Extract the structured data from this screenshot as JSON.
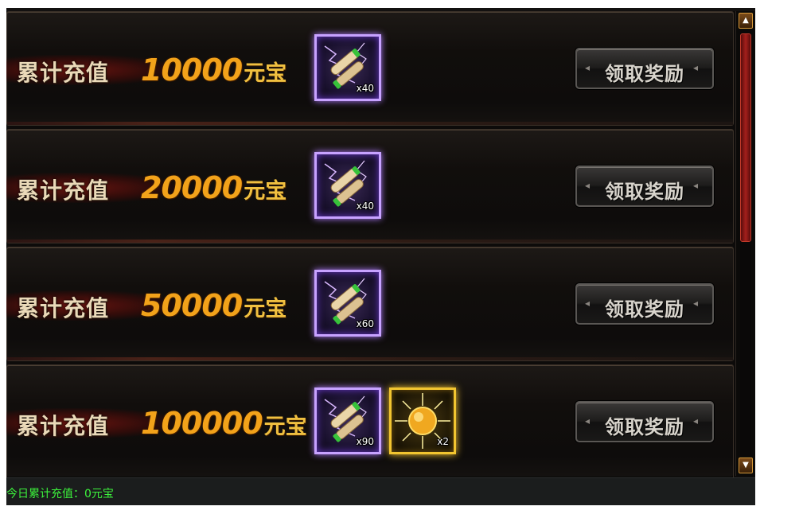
{
  "rewards": [
    {
      "label": "累计充值",
      "amount": "10000",
      "unit": "元宝",
      "items": [
        {
          "icon": "scroll-icon",
          "count": "x40"
        }
      ],
      "button": "领取奖励"
    },
    {
      "label": "累计充值",
      "amount": "20000",
      "unit": "元宝",
      "items": [
        {
          "icon": "scroll-icon",
          "count": "x40"
        }
      ],
      "button": "领取奖励"
    },
    {
      "label": "累计充值",
      "amount": "50000",
      "unit": "元宝",
      "items": [
        {
          "icon": "scroll-icon",
          "count": "x60"
        }
      ],
      "button": "领取奖励"
    },
    {
      "label": "累计充值",
      "amount": "100000",
      "unit": "元宝",
      "items": [
        {
          "icon": "scroll-icon",
          "count": "x90"
        },
        {
          "icon": "golden-orb-icon",
          "count": "x2"
        }
      ],
      "button": "领取奖励"
    }
  ],
  "footer": {
    "text": "今日累计充值：0元宝"
  },
  "colors": {
    "amount": "#f2a21a",
    "footer_text": "#3cf23c",
    "scroll_frame": "#c7a2ff",
    "orb_frame": "#f2c530"
  }
}
